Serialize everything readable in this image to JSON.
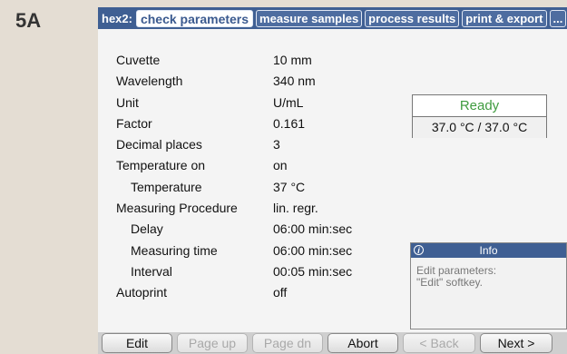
{
  "figure_label": "5A",
  "tabbar": {
    "prefix": "hex2:",
    "tabs": [
      {
        "label": "check parameters",
        "active": true
      },
      {
        "label": "measure samples"
      },
      {
        "label": "process results"
      },
      {
        "label": "print & export"
      },
      {
        "label": "..."
      }
    ]
  },
  "parameters": [
    {
      "label": "Cuvette",
      "value": "10 mm"
    },
    {
      "label": "Wavelength",
      "value": "340 nm"
    },
    {
      "label": "Unit",
      "value": "U/mL"
    },
    {
      "label": "Factor",
      "value": "0.161"
    },
    {
      "label": "Decimal places",
      "value": "3"
    },
    {
      "label": "Temperature on",
      "value": "on"
    },
    {
      "label": "Temperature",
      "value": "37  °C",
      "indent": true
    },
    {
      "label": "Measuring Procedure",
      "value": "lin. regr."
    },
    {
      "label": "Delay",
      "value": "06:00  min:sec",
      "indent": true
    },
    {
      "label": "Measuring time",
      "value": "06:00  min:sec",
      "indent": true
    },
    {
      "label": "Interval",
      "value": "00:05  min:sec",
      "indent": true
    },
    {
      "label": "Autoprint",
      "value": "off"
    }
  ],
  "status": {
    "state": "Ready",
    "state_color": "#3f9b3f",
    "temperature": "37.0 °C / 37.0 °C"
  },
  "info": {
    "title": "Info",
    "icon": "info-icon",
    "text_line1": "Edit parameters:",
    "text_line2": "\"Edit\" softkey."
  },
  "softkeys": [
    {
      "label": "Edit",
      "enabled": true
    },
    {
      "label": "Page up",
      "enabled": false
    },
    {
      "label": "Page dn",
      "enabled": false
    },
    {
      "label": "Abort",
      "enabled": true
    },
    {
      "label": "< Back",
      "enabled": false
    },
    {
      "label": "Next >",
      "enabled": true
    }
  ],
  "colors": {
    "accent": "#3f5f93",
    "background": "#e4ddd3"
  }
}
